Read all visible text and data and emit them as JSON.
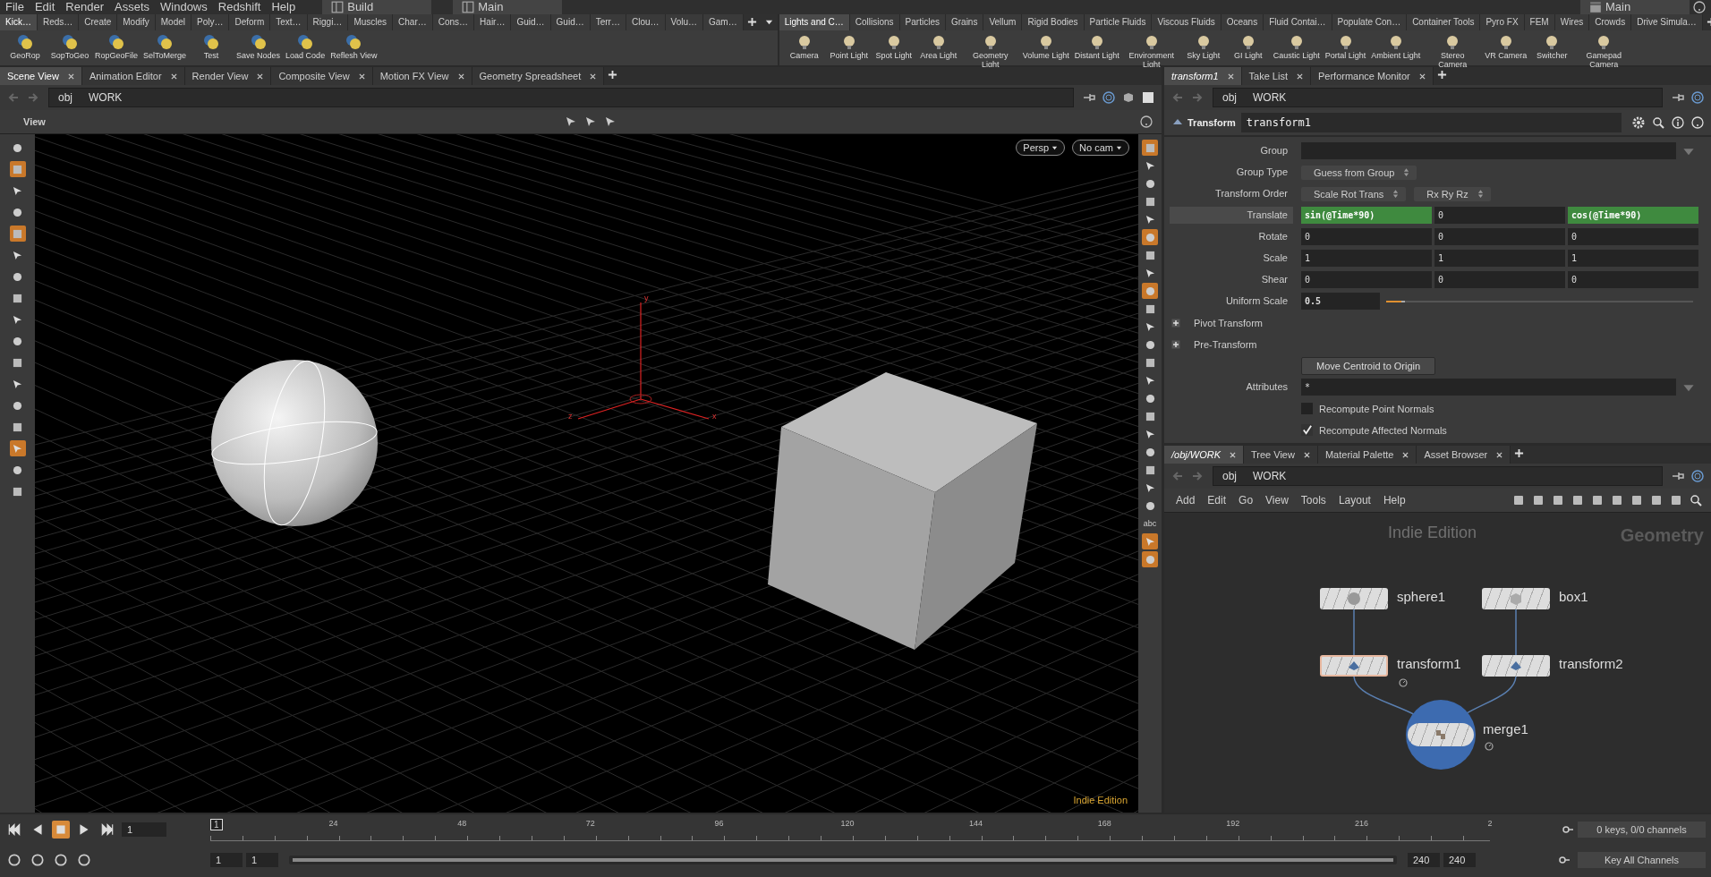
{
  "menu": [
    "File",
    "Edit",
    "Render",
    "Assets",
    "Windows",
    "Redshift",
    "Help"
  ],
  "desktops": [
    {
      "label": "Build"
    },
    {
      "label": "Main"
    }
  ],
  "right_desktop": {
    "label": "Main"
  },
  "shelf_left": {
    "tabs": [
      {
        "label": "Kick…",
        "selected": true
      },
      {
        "label": "Reds…",
        "selected": false
      },
      {
        "label": "Create",
        "selected": false
      },
      {
        "label": "Modify",
        "selected": false
      },
      {
        "label": "Model",
        "selected": false
      },
      {
        "label": "Poly…",
        "selected": false
      },
      {
        "label": "Deform",
        "selected": false
      },
      {
        "label": "Text…",
        "selected": false
      },
      {
        "label": "Riggi…",
        "selected": false
      },
      {
        "label": "Muscles",
        "selected": false
      },
      {
        "label": "Char…",
        "selected": false
      },
      {
        "label": "Cons…",
        "selected": false
      },
      {
        "label": "Hair…",
        "selected": false
      },
      {
        "label": "Guid…",
        "selected": false
      },
      {
        "label": "Guid…",
        "selected": false
      },
      {
        "label": "Terr…",
        "selected": false
      },
      {
        "label": "Clou…",
        "selected": false
      },
      {
        "label": "Volu…",
        "selected": false
      },
      {
        "label": "Gam…",
        "selected": false
      }
    ],
    "tools": [
      "GeoRop",
      "SopToGeo",
      "RopGeoFile",
      "SelToMerge",
      "Test",
      "Save Nodes",
      "Load Code",
      "Reflesh View"
    ]
  },
  "shelf_right": {
    "tabs": [
      {
        "label": "Lights and C…",
        "selected": true
      },
      {
        "label": "Collisions",
        "selected": false
      },
      {
        "label": "Particles",
        "selected": false
      },
      {
        "label": "Grains",
        "selected": false
      },
      {
        "label": "Vellum",
        "selected": false
      },
      {
        "label": "Rigid Bodies",
        "selected": false
      },
      {
        "label": "Particle Fluids",
        "selected": false
      },
      {
        "label": "Viscous Fluids",
        "selected": false
      },
      {
        "label": "Oceans",
        "selected": false
      },
      {
        "label": "Fluid Contai…",
        "selected": false
      },
      {
        "label": "Populate Con…",
        "selected": false
      },
      {
        "label": "Container Tools",
        "selected": false
      },
      {
        "label": "Pyro FX",
        "selected": false
      },
      {
        "label": "FEM",
        "selected": false
      },
      {
        "label": "Wires",
        "selected": false
      },
      {
        "label": "Crowds",
        "selected": false
      },
      {
        "label": "Drive Simula…",
        "selected": false
      }
    ],
    "tools": [
      "Camera",
      "Point Light",
      "Spot Light",
      "Area Light",
      "Geometry Light",
      "Volume Light",
      "Distant Light",
      "Environment Light",
      "Sky Light",
      "GI Light",
      "Caustic Light",
      "Portal Light",
      "Ambient Light",
      "Stereo Camera",
      "VR Camera",
      "Switcher",
      "Gamepad Camera"
    ]
  },
  "scene_pane": {
    "tabs": [
      {
        "label": "Scene View",
        "selected": true
      },
      {
        "label": "Animation Editor",
        "selected": false
      },
      {
        "label": "Render View",
        "selected": false
      },
      {
        "label": "Composite View",
        "selected": false
      },
      {
        "label": "Motion FX View",
        "selected": false
      },
      {
        "label": "Geometry Spreadsheet",
        "selected": false
      }
    ],
    "path": [
      "obj",
      "WORK"
    ],
    "toolbar_title": "View",
    "camera_menus": [
      "Persp",
      "No cam"
    ],
    "watermark": "Indie Edition",
    "axis_labels": [
      "y",
      "z",
      "x"
    ],
    "left_tools": [
      {
        "on": false
      },
      {
        "on": true
      },
      {
        "on": false
      },
      {
        "on": false
      },
      {
        "on": true
      },
      {
        "on": false
      },
      {
        "on": false
      },
      {
        "on": false
      },
      {
        "on": false
      },
      {
        "on": false
      },
      {
        "on": false
      },
      {
        "on": false
      },
      {
        "on": false
      },
      {
        "on": false
      },
      {
        "on": true
      },
      {
        "on": false
      },
      {
        "on": false
      }
    ],
    "right_tools": [
      {
        "kind": "icon",
        "on": true
      },
      {
        "kind": "icon",
        "on": false
      },
      {
        "kind": "icon",
        "on": false
      },
      {
        "kind": "icon",
        "on": false
      },
      {
        "kind": "icon",
        "on": false
      },
      {
        "kind": "icon",
        "on": true
      },
      {
        "kind": "icon",
        "on": false
      },
      {
        "kind": "icon",
        "on": false
      },
      {
        "kind": "icon",
        "on": true
      },
      {
        "kind": "icon",
        "on": false
      },
      {
        "kind": "icon",
        "on": false
      },
      {
        "kind": "icon",
        "on": false
      },
      {
        "kind": "icon",
        "on": false
      },
      {
        "kind": "icon",
        "on": false
      },
      {
        "kind": "icon",
        "on": false
      },
      {
        "kind": "icon",
        "on": false
      },
      {
        "kind": "icon",
        "on": false
      },
      {
        "kind": "icon",
        "on": false
      },
      {
        "kind": "icon",
        "on": false
      },
      {
        "kind": "icon",
        "on": false
      },
      {
        "kind": "icon",
        "on": false
      },
      {
        "kind": "text",
        "label": "abc",
        "on": false
      },
      {
        "kind": "icon",
        "on": true
      },
      {
        "kind": "icon",
        "on": true
      }
    ]
  },
  "parm_pane": {
    "tabs": [
      {
        "label": "transform1",
        "selected": true
      },
      {
        "label": "Take List",
        "selected": false
      },
      {
        "label": "Performance Monitor",
        "selected": false
      }
    ],
    "path": [
      "obj",
      "WORK"
    ],
    "node_type": "Transform",
    "node_name": "transform1",
    "params": [
      {
        "kind": "field",
        "label": "Group"
      },
      {
        "kind": "menus",
        "label": "Group Type",
        "values": [
          "Guess from Group"
        ]
      },
      {
        "kind": "menus",
        "label": "Transform Order",
        "values": [
          "Scale Rot Trans",
          "Rx Ry Rz"
        ]
      },
      {
        "kind": "vector",
        "label": "Translate",
        "highlighted": true,
        "values": [
          {
            "text": "sin(@Time*90)",
            "expression": true
          },
          {
            "text": "0",
            "expression": false
          },
          {
            "text": "cos(@Time*90)",
            "expression": true
          }
        ]
      },
      {
        "kind": "vector",
        "label": "Rotate",
        "highlighted": false,
        "values": [
          {
            "text": "0",
            "expression": false
          },
          {
            "text": "0",
            "expression": false
          },
          {
            "text": "0",
            "expression": false
          }
        ]
      },
      {
        "kind": "vector",
        "label": "Scale",
        "highlighted": false,
        "values": [
          {
            "text": "1",
            "expression": false
          },
          {
            "text": "1",
            "expression": false
          },
          {
            "text": "1",
            "expression": false
          }
        ]
      },
      {
        "kind": "vector",
        "label": "Shear",
        "highlighted": false,
        "values": [
          {
            "text": "0",
            "expression": false
          },
          {
            "text": "0",
            "expression": false
          },
          {
            "text": "0",
            "expression": false
          }
        ]
      },
      {
        "kind": "slider",
        "label": "Uniform Scale",
        "value": "0.5",
        "level": 0.05
      },
      {
        "kind": "folder",
        "label": "Pivot Transform",
        "expanded": false
      },
      {
        "kind": "folder",
        "label": "Pre-Transform",
        "expanded": false
      },
      {
        "kind": "button",
        "label": "Move Centroid to Origin"
      },
      {
        "kind": "field",
        "label": "Attributes",
        "value": "*"
      },
      {
        "kind": "checkbox",
        "label": "Recompute Point Normals",
        "checked": false
      },
      {
        "kind": "checkbox",
        "label": "Recompute Affected Normals",
        "checked": true
      }
    ]
  },
  "network_pane": {
    "tabs": [
      {
        "label": "/obj/WORK",
        "selected": true
      },
      {
        "label": "Tree View",
        "selected": false
      },
      {
        "label": "Material Palette",
        "selected": false
      },
      {
        "label": "Asset Browser",
        "selected": false
      }
    ],
    "path": [
      "obj",
      "WORK"
    ],
    "menu": [
      "Add",
      "Edit",
      "Go",
      "View",
      "Tools",
      "Layout",
      "Help"
    ],
    "watermark": "Indie Edition",
    "context": "Geometry",
    "nodes": [
      {
        "name": "sphere1",
        "kind": "sphere",
        "selected": false,
        "display": false,
        "time_dependent": false
      },
      {
        "name": "box1",
        "kind": "box",
        "selected": false,
        "display": false,
        "time_dependent": false
      },
      {
        "name": "transform1",
        "kind": "transform",
        "selected": true,
        "display": false,
        "time_dependent": true
      },
      {
        "name": "transform2",
        "kind": "transform",
        "selected": false,
        "display": false,
        "time_dependent": false
      },
      {
        "name": "merge1",
        "kind": "merge",
        "selected": false,
        "display": true,
        "time_dependent": true
      }
    ]
  },
  "timeline": {
    "frame": "1",
    "ruler_start": "1",
    "ruler_labels": [
      "24",
      "48",
      "72",
      "96",
      "120",
      "144",
      "168",
      "192",
      "216",
      "2"
    ],
    "range_start": [
      "1",
      "1"
    ],
    "range_bar": {
      "level": 1
    },
    "range_end": [
      "240",
      "240"
    ],
    "keys_status": "0 keys, 0/0 channels",
    "key_menu": "Key All Channels",
    "playing": true
  }
}
